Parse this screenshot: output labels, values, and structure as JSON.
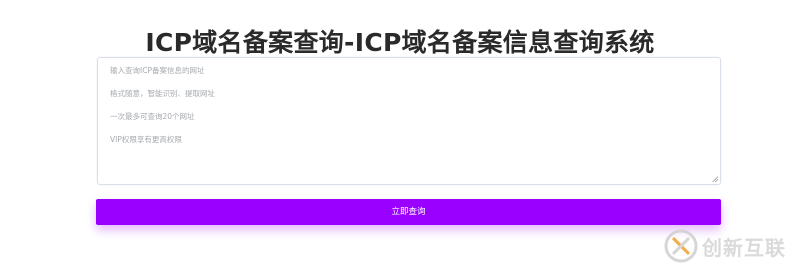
{
  "page": {
    "title": "ICP域名备案查询-ICP域名备案信息查询系统"
  },
  "query": {
    "hints": [
      "输入查询ICP备案信息的网址",
      "格式随意，智能识别、提取网址",
      "一次最多可查询20个网址",
      "VIP权限享有更高权限"
    ],
    "submit_label": "立即查询"
  },
  "watermark": {
    "text": "创新互联",
    "icon": "brand-logo-icon"
  },
  "colors": {
    "accent": "#9a00ff",
    "title": "#2a2a2a",
    "hint": "#a5a9ae",
    "border": "#d9dfe6"
  }
}
